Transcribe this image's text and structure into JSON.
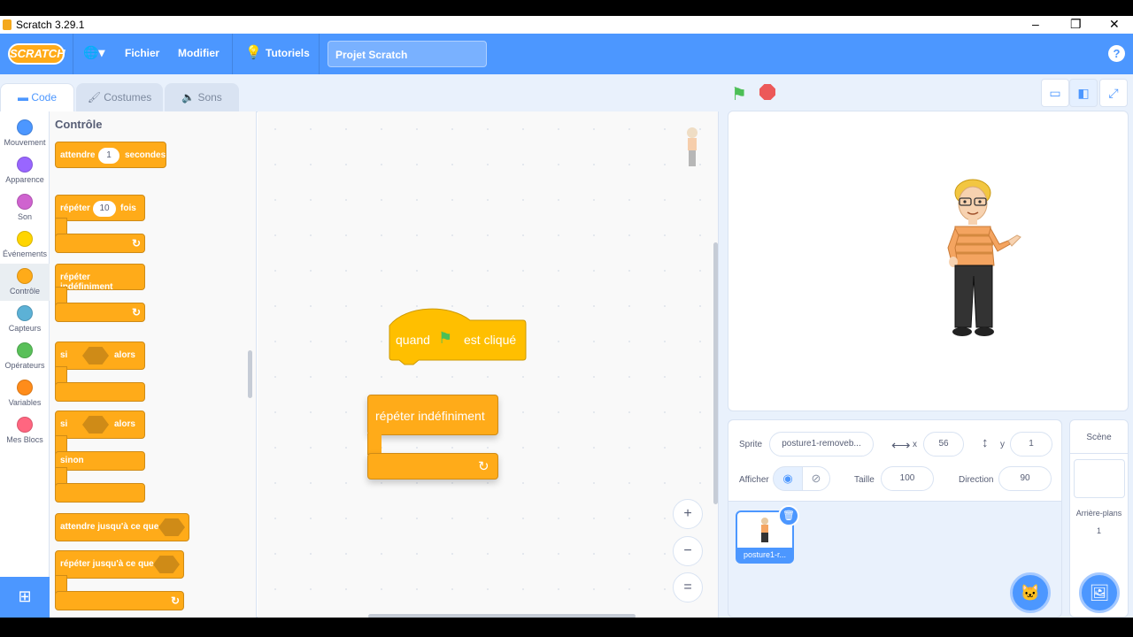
{
  "window": {
    "title": "Scratch 3.29.1",
    "minimize": "–",
    "maximize": "❐",
    "close": "✕"
  },
  "menubar": {
    "logo": "SCRATCH",
    "globe": "🌐▾",
    "file": "Fichier",
    "edit": "Modifier",
    "tutorials": "Tutoriels",
    "project_title": "Projet Scratch",
    "help": "?"
  },
  "tabs": {
    "code": "Code",
    "costumes": "Costumes",
    "sounds": "Sons"
  },
  "categories": [
    {
      "label": "Mouvement",
      "color": "#4c97ff"
    },
    {
      "label": "Apparence",
      "color": "#9966ff"
    },
    {
      "label": "Son",
      "color": "#cf63cf"
    },
    {
      "label": "Événements",
      "color": "#ffd500"
    },
    {
      "label": "Contrôle",
      "color": "#ffab19"
    },
    {
      "label": "Capteurs",
      "color": "#5cb1d6"
    },
    {
      "label": "Opérateurs",
      "color": "#59c059"
    },
    {
      "label": "Variables",
      "color": "#ff8c1a"
    },
    {
      "label": "Mes Blocs",
      "color": "#ff6680"
    }
  ],
  "palette": {
    "title": "Contrôle",
    "wait": {
      "label": "attendre",
      "value": "1",
      "unit": "secondes"
    },
    "repeat": {
      "label": "répéter",
      "value": "10",
      "unit": "fois"
    },
    "forever": "répéter indéfiniment",
    "if_then": {
      "if": "si",
      "then": "alors"
    },
    "if_else": {
      "if": "si",
      "then": "alors",
      "else": "sinon"
    },
    "wait_until": "attendre jusqu'à ce que",
    "repeat_until": "répéter jusqu'à ce que"
  },
  "script": {
    "hat_when": "quand",
    "hat_clicked": "est cliqué",
    "forever": "répéter indéfiniment"
  },
  "zoom": {
    "in": "+",
    "out": "−",
    "reset": "="
  },
  "sprite_info": {
    "sprite_label": "Sprite",
    "sprite_name": "posture1-removeb...",
    "x_label": "x",
    "x": "56",
    "y_label": "y",
    "y": "1",
    "show_label": "Afficher",
    "size_label": "Taille",
    "size": "100",
    "direction_label": "Direction",
    "direction": "90"
  },
  "sprite_thumb": {
    "name": "posture1-r..."
  },
  "stage_panel": {
    "title": "Scène",
    "backdrops_label": "Arrière-plans",
    "backdrops_count": "1"
  },
  "colors": {
    "accent": "#4c97ff",
    "control": "#ffab19",
    "control_dark": "#cf8b17"
  }
}
